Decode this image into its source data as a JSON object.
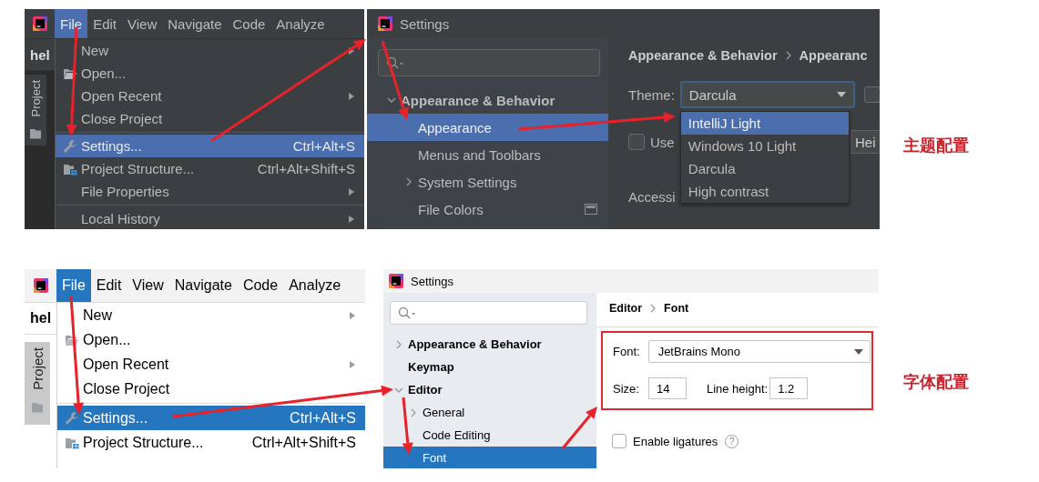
{
  "examples": [
    {
      "caption": "主题配置",
      "menu": {
        "kind": "dark",
        "project_label": "hel",
        "tool_window": "Project",
        "menubar": [
          {
            "label": "File",
            "selected": true
          },
          {
            "label": "Edit",
            "selected": false
          },
          {
            "label": "View",
            "selected": false
          },
          {
            "label": "Navigate",
            "selected": false
          },
          {
            "label": "Code",
            "selected": false
          },
          {
            "label": "Analyze",
            "selected": false
          }
        ],
        "items": [
          {
            "kind": "item",
            "label": "New",
            "submenu": true,
            "selected": false
          },
          {
            "kind": "open",
            "label": "Open...",
            "submenu": false,
            "selected": false
          },
          {
            "kind": "item",
            "label": "Open Recent",
            "submenu": true,
            "selected": false
          },
          {
            "kind": "item",
            "label": "Close Project",
            "submenu": false,
            "selected": false
          },
          {
            "kind": "separator"
          },
          {
            "kind": "settings",
            "label": "Settings...",
            "shortcut": "Ctrl+Alt+S",
            "submenu": false,
            "selected": true
          },
          {
            "kind": "structure",
            "label": "Project Structure...",
            "shortcut": "Ctrl+Alt+Shift+S",
            "submenu": false,
            "selected": false
          },
          {
            "kind": "item",
            "label": "File Properties",
            "submenu": true,
            "selected": false
          },
          {
            "kind": "separator"
          },
          {
            "kind": "item",
            "label": "Local History",
            "submenu": true,
            "selected": false
          }
        ]
      },
      "settings": {
        "kind": "dark",
        "title": "Settings",
        "tree": [
          {
            "kind": "group",
            "label": "Appearance & Behavior",
            "expanded": true,
            "selected": false,
            "children": [
              {
                "kind": "leaf",
                "label": "Appearance",
                "selected": true
              },
              {
                "kind": "leaf",
                "label": "Menus and Toolbars",
                "selected": false
              },
              {
                "kind": "group",
                "label": "System Settings",
                "expanded": false,
                "selected": false
              },
              {
                "kind": "leaf",
                "label": "File Colors",
                "selected": false,
                "project_icon": true
              }
            ]
          }
        ],
        "breadcrumb": [
          "Appearance & Behavior",
          "Appearanc"
        ],
        "page": {
          "kind": "appearance",
          "theme_label": "Theme:",
          "theme_value": "Darcula",
          "theme_options": [
            {
              "label": "IntelliJ Light",
              "selected": true
            },
            {
              "label": "Windows 10 Light",
              "selected": false
            },
            {
              "label": "Darcula",
              "selected": false
            },
            {
              "label": "High contrast",
              "selected": false
            }
          ],
          "side_checkbox": {
            "checked": false
          },
          "use_checkbox": {
            "label": "Use",
            "checked": false
          },
          "font_field": "Hei",
          "section": "Accessi"
        }
      }
    },
    {
      "caption": "字体配置",
      "menu": {
        "kind": "light",
        "project_label": "hel",
        "tool_window": "Project",
        "menubar": [
          {
            "label": "File",
            "selected": true
          },
          {
            "label": "Edit",
            "selected": false
          },
          {
            "label": "View",
            "selected": false
          },
          {
            "label": "Navigate",
            "selected": false
          },
          {
            "label": "Code",
            "selected": false
          },
          {
            "label": "Analyze",
            "selected": false
          }
        ],
        "items": [
          {
            "kind": "item",
            "label": "New",
            "submenu": true,
            "selected": false
          },
          {
            "kind": "open",
            "label": "Open...",
            "submenu": false,
            "selected": false
          },
          {
            "kind": "item",
            "label": "Open Recent",
            "submenu": true,
            "selected": false
          },
          {
            "kind": "item",
            "label": "Close Project",
            "submenu": false,
            "selected": false
          },
          {
            "kind": "separator"
          },
          {
            "kind": "settings",
            "label": "Settings...",
            "shortcut": "Ctrl+Alt+S",
            "submenu": false,
            "selected": true
          },
          {
            "kind": "structure",
            "label": "Project Structure...",
            "shortcut": "Ctrl+Alt+Shift+S",
            "submenu": false,
            "selected": false
          }
        ]
      },
      "settings": {
        "kind": "light",
        "title": "Settings",
        "tree": [
          {
            "kind": "group",
            "label": "Appearance & Behavior",
            "expanded": false,
            "selected": false
          },
          {
            "kind": "leaf",
            "label": "Keymap",
            "selected": false
          },
          {
            "kind": "group",
            "label": "Editor",
            "expanded": true,
            "selected": false,
            "children": [
              {
                "kind": "group",
                "label": "General",
                "expanded": false,
                "selected": false
              },
              {
                "kind": "leaf",
                "label": "Code Editing",
                "selected": false
              },
              {
                "kind": "leaf",
                "label": "Font",
                "selected": true
              }
            ]
          }
        ],
        "breadcrumb": [
          "Editor",
          "Font"
        ],
        "page": {
          "kind": "font",
          "highlighted": true,
          "font_label": "Font:",
          "font_value": "JetBrains Mono",
          "size_label": "Size:",
          "size_value": "14",
          "line_height_label": "Line height:",
          "line_height_value": "1.2",
          "ligatures": {
            "label": "Enable ligatures",
            "checked": false
          },
          "help": "?"
        }
      }
    }
  ]
}
